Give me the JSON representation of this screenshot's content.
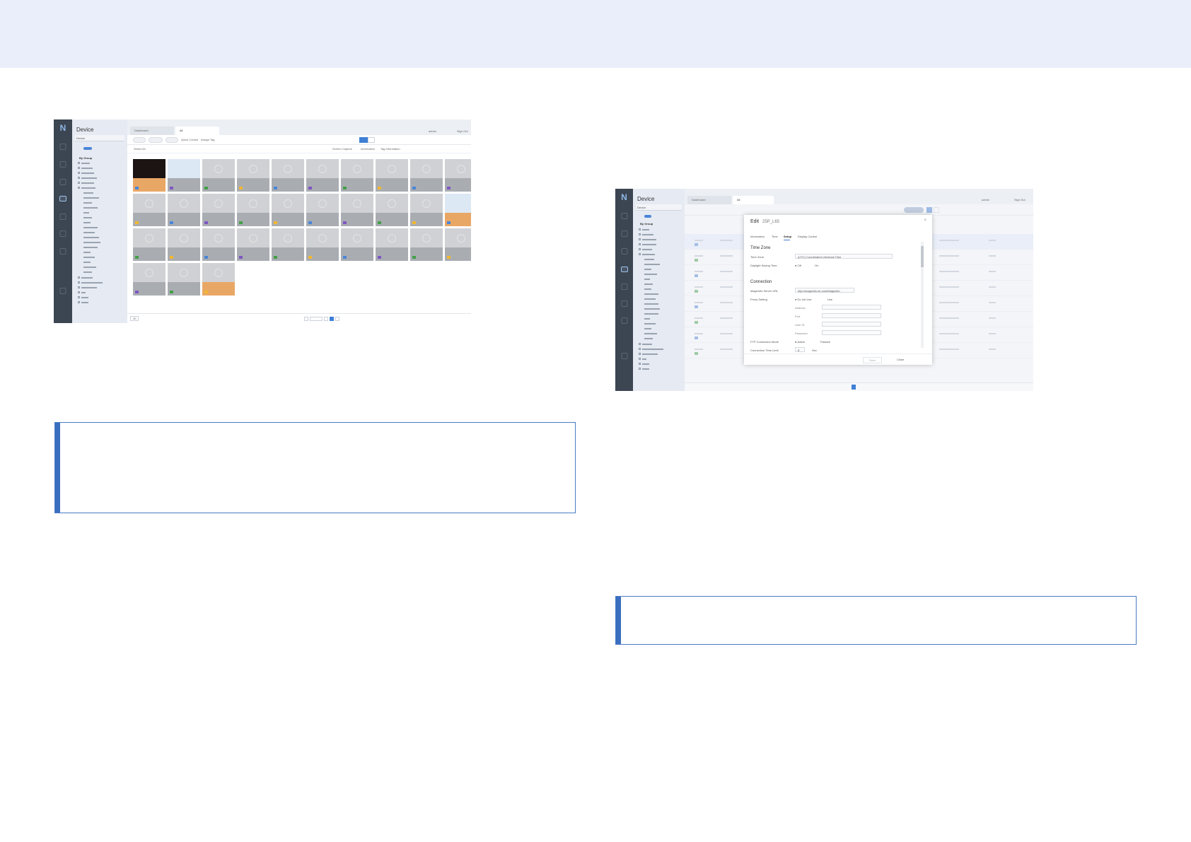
{
  "page": {
    "band_color": "#e9eefa",
    "accent": "#3a6fc0"
  },
  "shot1": {
    "sidebar_title": "Device",
    "sidebar_select": "Device",
    "tree_header": "By Group",
    "tabs": [
      {
        "label": "Dashboard",
        "icon": "grid-icon"
      },
      {
        "label": "All",
        "icon": "monitor-icon"
      }
    ],
    "user": "admin",
    "sign_out": "Sign Out",
    "toolbar": [
      "Edit",
      "Delete",
      "Move",
      "Quick Control",
      "Assign Tag"
    ],
    "toolbar2": [
      "Screen Capture",
      "Information",
      "Tag Information"
    ],
    "select_all": "Select All",
    "footer_per_page": "30",
    "pager_current": "5"
  },
  "shot2": {
    "sidebar_title": "Device",
    "sidebar_select": "Device",
    "tree_header": "By Group",
    "tabs": [
      {
        "label": "Dashboard"
      },
      {
        "label": "All"
      }
    ],
    "user": "admin",
    "sign_out": "Sign Out",
    "dialog": {
      "title": "Edit",
      "device": "25P_L65",
      "tabs": [
        "Information",
        "Time",
        "Setup",
        "Display Control"
      ],
      "active_tab": "Setup",
      "section_time_zone": "Time Zone",
      "time_zone_label": "Time Zone",
      "time_zone_value": "(UTC) Coordinated Universal Time",
      "dst_label": "Daylight Saving Time",
      "dst_off": "Off",
      "dst_on": "On",
      "section_connection": "Connection",
      "server_label": "MagicInfo Server URL",
      "server_value": "http://magicinfo.sh.com/MagicInfo",
      "proxy_label": "Proxy Setting",
      "proxy_off": "Do not Use",
      "proxy_on": "Use",
      "proxy_fields": [
        "Address",
        "Port",
        "User ID",
        "Password"
      ],
      "ftp_label": "FTP Connection Mode",
      "ftp_active": "Active",
      "ftp_passive": "Passive",
      "timeout_label": "Connection Time Limit",
      "timeout_value": "0",
      "timeout_unit": "Sec",
      "save": "Save",
      "close": "Close"
    }
  }
}
